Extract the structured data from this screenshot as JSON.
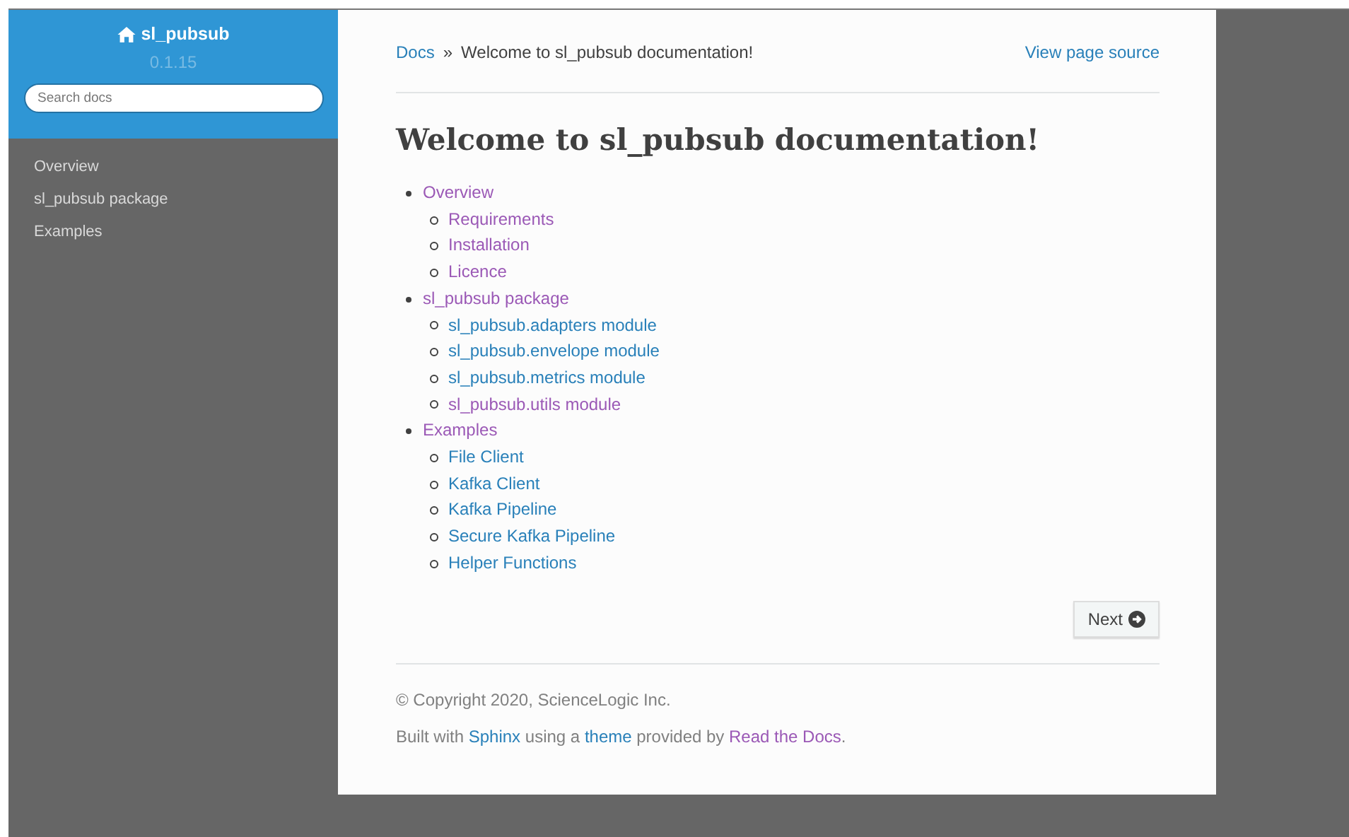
{
  "sidebar": {
    "project": "sl_pubsub",
    "version": "0.1.15",
    "search": {
      "placeholder": "Search docs"
    },
    "items": [
      {
        "label": "Overview"
      },
      {
        "label": "sl_pubsub package"
      },
      {
        "label": "Examples"
      }
    ]
  },
  "breadcrumbs": {
    "items": [
      {
        "label": "Docs",
        "kind": "link"
      },
      {
        "label": "»",
        "kind": "text"
      },
      {
        "label": "Welcome to sl_pubsub documentation!",
        "kind": "text"
      }
    ],
    "source_link": "View page source"
  },
  "title": "Welcome to sl_pubsub documentation!",
  "toc": [
    {
      "label": "Overview",
      "visited": true,
      "children": [
        {
          "label": "Requirements",
          "visited": true
        },
        {
          "label": "Installation",
          "visited": true
        },
        {
          "label": "Licence",
          "visited": true
        }
      ]
    },
    {
      "label": "sl_pubsub package",
      "visited": true,
      "children": [
        {
          "label": "sl_pubsub.adapters module",
          "visited": false
        },
        {
          "label": "sl_pubsub.envelope module",
          "visited": false
        },
        {
          "label": "sl_pubsub.metrics module",
          "visited": false
        },
        {
          "label": "sl_pubsub.utils module",
          "visited": true
        }
      ]
    },
    {
      "label": "Examples",
      "visited": true,
      "children": [
        {
          "label": "File Client",
          "visited": false
        },
        {
          "label": "Kafka Client",
          "visited": false
        },
        {
          "label": "Kafka Pipeline",
          "visited": false
        },
        {
          "label": "Secure Kafka Pipeline",
          "visited": false
        },
        {
          "label": "Helper Functions",
          "visited": false
        }
      ]
    }
  ],
  "next_button": "Next",
  "footer": {
    "copyright": "© Copyright 2020, ScienceLogic Inc.",
    "built_with": [
      {
        "text": "Built with ",
        "kind": "text"
      },
      {
        "text": "Sphinx",
        "kind": "link"
      },
      {
        "text": " using a ",
        "kind": "text"
      },
      {
        "text": "theme",
        "kind": "link"
      },
      {
        "text": " provided by ",
        "kind": "text"
      },
      {
        "text": "Read the Docs",
        "kind": "visited-link"
      },
      {
        "text": ".",
        "kind": "text"
      }
    ]
  }
}
